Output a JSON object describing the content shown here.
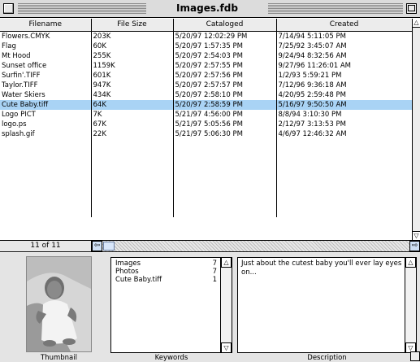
{
  "window": {
    "title": "Images.fdb"
  },
  "table": {
    "headers": [
      "Filename",
      "File Size",
      "Cataloged",
      "Created"
    ],
    "rows": [
      [
        "Flowers.CMYK",
        "203K",
        "5/20/97 12:02:29 PM",
        "7/14/94 5:11:05 PM"
      ],
      [
        "Flag",
        "60K",
        "5/20/97 1:57:35 PM",
        "7/25/92 3:45:07 AM"
      ],
      [
        "Mt Hood",
        "255K",
        "5/20/97 2:54:03 PM",
        "9/24/94 8:32:56 AM"
      ],
      [
        "Sunset office",
        "1159K",
        "5/20/97 2:57:55 PM",
        "9/27/96 11:26:01 AM"
      ],
      [
        "Surfin'.TIFF",
        "601K",
        "5/20/97 2:57:56 PM",
        "1/2/93 5:59:21 PM"
      ],
      [
        "Taylor.TIFF",
        "947K",
        "5/20/97 2:57:57 PM",
        "7/12/96 9:36:18 AM"
      ],
      [
        "Water Skiers",
        "434K",
        "5/20/97 2:58:10 PM",
        "4/20/95 2:59:48 PM"
      ],
      [
        "Cute Baby.tiff",
        "64K",
        "5/20/97 2:58:59 PM",
        "5/16/97 9:50:50 AM"
      ],
      [
        "Logo PICT",
        "7K",
        "5/21/97 4:56:00 PM",
        "8/8/94 3:10:30 PM"
      ],
      [
        "logo.ps",
        "67K",
        "5/21/97 5:05:56 PM",
        "2/12/97 3:13:53 PM"
      ],
      [
        "splash.gif",
        "22K",
        "5/21/97 5:06:30 PM",
        "4/6/97 12:46:32 AM"
      ]
    ],
    "selected_row": 7
  },
  "status": {
    "record_count": "11 of 11"
  },
  "details": {
    "thumbnail_label": "Thumbnail",
    "keywords_label": "Keywords",
    "description_label": "Description",
    "keywords": [
      {
        "name": "Images",
        "count": "7"
      },
      {
        "name": "Photos",
        "count": "7"
      },
      {
        "name": "Cute Baby.tiff",
        "count": "1"
      }
    ],
    "description": "Just about the cutest baby you'll ever lay eyes on..."
  },
  "colors": {
    "selection": "#a9d3f5",
    "chrome": "#dcdcdc"
  }
}
